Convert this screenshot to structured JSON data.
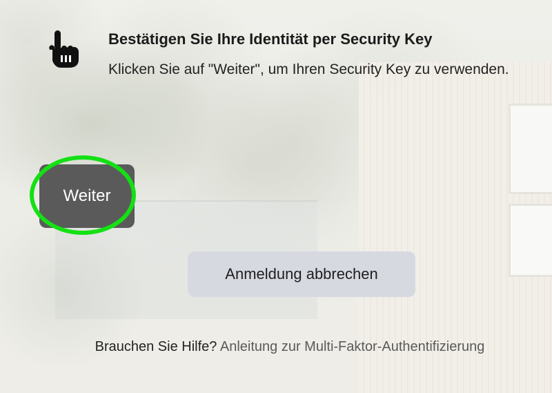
{
  "prompt": {
    "icon": "hand-pointer-icon",
    "title": "Bestätigen Sie Ihre Identität per Security Key",
    "description": "Klicken Sie auf \"Weiter\", um Ihren Security Key zu verwenden."
  },
  "actions": {
    "continue_label": "Weiter",
    "cancel_label": "Anmeldung abbrechen"
  },
  "help": {
    "text": "Brauchen Sie Hilfe?",
    "link_label": "Anleitung zur Multi-Faktor-Authentifizierung"
  },
  "colors": {
    "continue_button": "#5a5a5b",
    "cancel_button": "#d6d9e0",
    "highlight": "#14e014"
  }
}
